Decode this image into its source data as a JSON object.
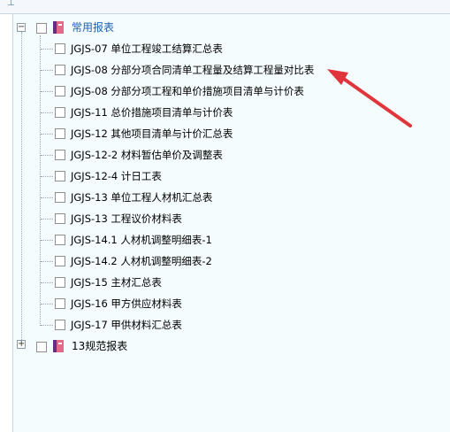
{
  "toolbar_fragment": {
    "glyph": "⊥"
  },
  "tree": {
    "groups": [
      {
        "label": "常用报表",
        "expander": "−",
        "items": [
          {
            "label": "JGJS-07 单位工程竣工结算汇总表"
          },
          {
            "label": "JGJS-08 分部分项合同清单工程量及结算工程量对比表"
          },
          {
            "label": "JGJS-08 分部分项工程和单价措施项目清单与计价表"
          },
          {
            "label": "JGJS-11 总价措施项目清单与计价表"
          },
          {
            "label": "JGJS-12 其他项目清单与计价汇总表"
          },
          {
            "label": "JGJS-12-2 材料暂估单价及调整表"
          },
          {
            "label": "JGJS-12-4 计日工表"
          },
          {
            "label": "JGJS-13 单位工程人材机汇总表"
          },
          {
            "label": "JGJS-13 工程议价材料表"
          },
          {
            "label": "JGJS-14.1 人材机调整明细表-1"
          },
          {
            "label": "JGJS-14.2 人材机调整明细表-2"
          },
          {
            "label": "JGJS-15 主材汇总表"
          },
          {
            "label": "JGJS-16 甲方供应材料表"
          },
          {
            "label": "JGJS-17 甲供材料汇总表"
          }
        ]
      },
      {
        "label": "13规范报表",
        "expander": "+",
        "items": []
      }
    ]
  },
  "colors": {
    "panel_bg": "#f5fcfd",
    "group_open_text": "#1a5fb4",
    "annotation_arrow": "#e0353b",
    "book_spine": "#6a2b86",
    "book_cover": "#e46a8a"
  },
  "icons": {
    "group": "book-icon",
    "annotation": "red-arrow-annotation"
  }
}
